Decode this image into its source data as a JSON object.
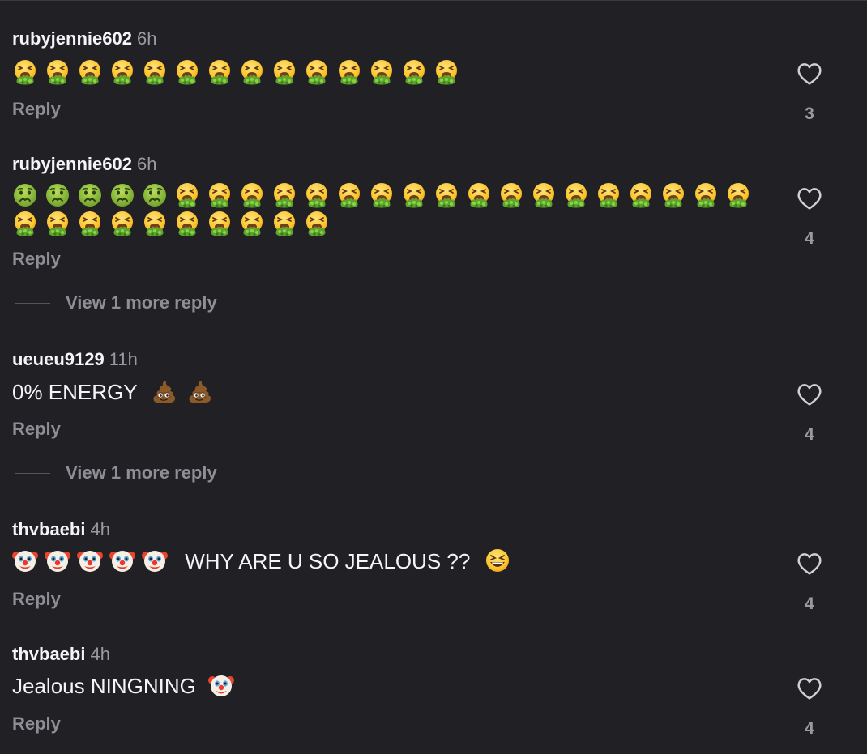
{
  "reply_label": "Reply",
  "view_more_label": "View 1 more reply",
  "comments": [
    {
      "username": "rubyjennie602",
      "time": "6h",
      "emojis": [
        "vomit-face",
        "vomit-face",
        "vomit-face",
        "vomit-face",
        "vomit-face",
        "vomit-face",
        "vomit-face",
        "vomit-face",
        "vomit-face",
        "vomit-face",
        "vomit-face",
        "vomit-face",
        "vomit-face",
        "vomit-face"
      ],
      "likes": "3"
    },
    {
      "username": "rubyjennie602",
      "time": "6h",
      "emojis_line1": [
        "nauseated-face",
        "nauseated-face",
        "nauseated-face",
        "nauseated-face",
        "nauseated-face",
        "vomit-face",
        "vomit-face",
        "vomit-face",
        "vomit-face",
        "vomit-face",
        "vomit-face",
        "vomit-face",
        "vomit-face",
        "vomit-face",
        "vomit-face",
        "vomit-face",
        "vomit-face",
        "vomit-face",
        "vomit-face",
        "vomit-face",
        "vomit-face",
        "vomit-face",
        "vomit-face"
      ],
      "emojis_line2": [
        "vomit-face",
        "vomit-face",
        "vomit-face",
        "vomit-face",
        "vomit-face",
        "vomit-face",
        "vomit-face",
        "vomit-face",
        "vomit-face",
        "vomit-face"
      ],
      "likes": "4",
      "has_more_replies": true
    },
    {
      "username": "ueueu9129",
      "time": "11h",
      "text": "0% ENERGY",
      "trailing_emojis": [
        "poop",
        "poop"
      ],
      "likes": "4",
      "has_more_replies": true
    },
    {
      "username": "thvbaebi",
      "time": "4h",
      "leading_emojis": [
        "clown-face",
        "clown-face",
        "clown-face",
        "clown-face",
        "clown-face"
      ],
      "text": "WHY ARE U SO JEALOUS ??",
      "trailing_emojis": [
        "grinning-squinting-face"
      ],
      "likes": "4"
    },
    {
      "username": "thvbaebi",
      "time": "4h",
      "text": "Jealous NINGNING",
      "trailing_emojis": [
        "clown-face"
      ],
      "likes": "4"
    }
  ],
  "colors": {
    "background": "#212125",
    "primary_text": "#f5f5f7",
    "secondary_text": "#8e8e94"
  }
}
